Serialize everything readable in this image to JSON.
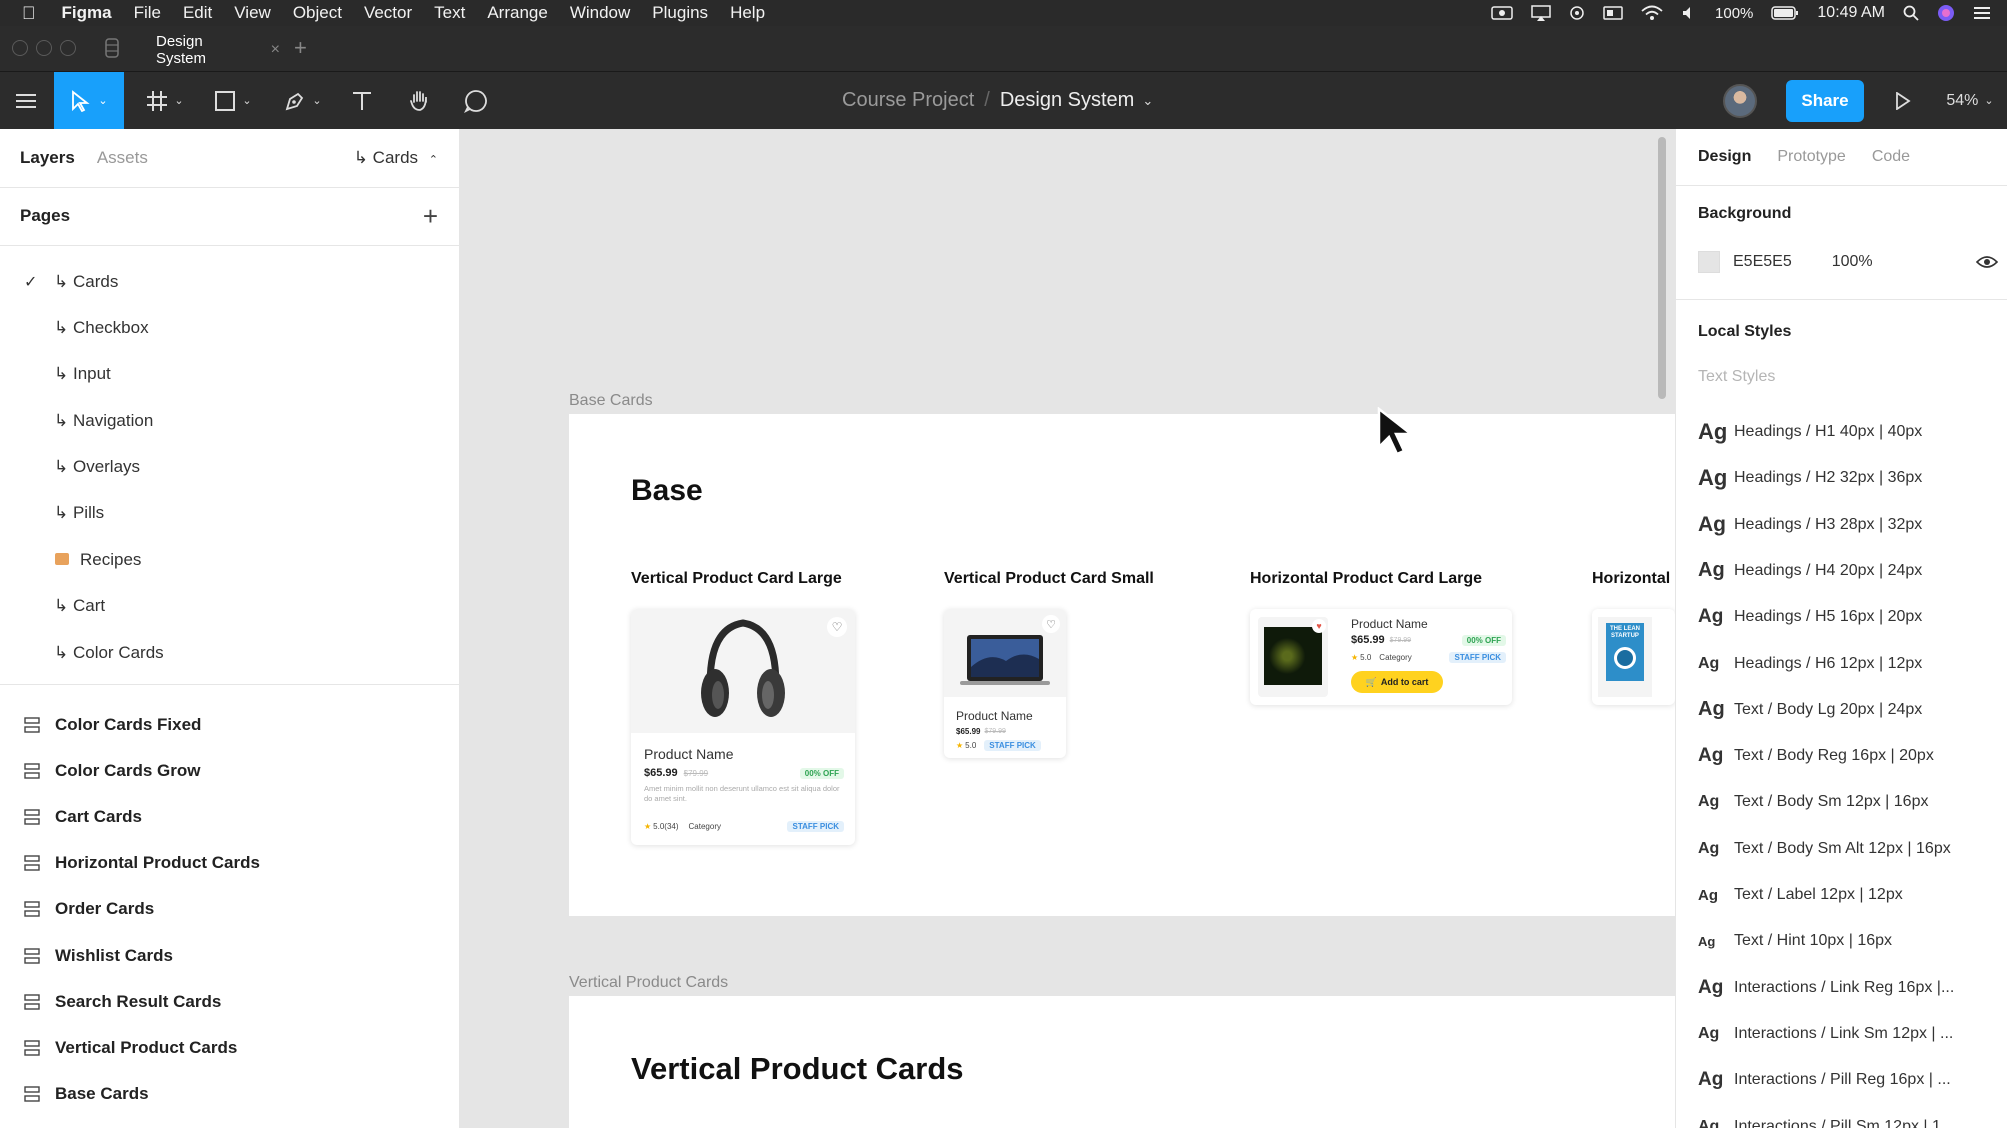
{
  "menubar": {
    "app": "Figma",
    "items": [
      "File",
      "Edit",
      "View",
      "Object",
      "Vector",
      "Text",
      "Arrange",
      "Window",
      "Plugins",
      "Help"
    ],
    "battery": "100%",
    "time": "10:49 AM"
  },
  "tabbar": {
    "tab_label": "Design System"
  },
  "toolbar": {
    "project": "Course Project",
    "separator": "/",
    "file": "Design System",
    "share_label": "Share",
    "zoom": "54%",
    "accent": "#18a0fb"
  },
  "left_panel": {
    "tabs": [
      "Layers",
      "Assets"
    ],
    "current_page_label": "↳ Cards",
    "pages_title": "Pages",
    "pages": [
      "↳ Cards",
      "↳ Checkbox",
      "↳ Input",
      "↳ Navigation",
      "↳ Overlays",
      "↳ Pills",
      "Recipes",
      "↳ Cart",
      "↳ Color Cards"
    ],
    "layers": [
      "Color Cards Fixed",
      "Color Cards Grow",
      "Cart Cards",
      "Horizontal Product Cards",
      "Order Cards",
      "Wishlist Cards",
      "Search Result Cards",
      "Vertical Product Cards",
      "Base Cards"
    ]
  },
  "canvas": {
    "frame1_label": "Base Cards",
    "frame1_heading": "Base",
    "col1_title": "Vertical Product Card Large",
    "col2_title": "Vertical Product Card Small",
    "col3_title": "Horizontal Product Card Large",
    "col4_title": "Horizontal",
    "card_large": {
      "name": "Product Name",
      "price": "$65.99",
      "old_price": "$79.99",
      "discount": "00% OFF",
      "desc": "Amet minim mollit non deserunt ullamco est sit aliqua dolor do amet sint.",
      "rating": "5.0(34)",
      "category": "Category",
      "badge": "STAFF PICK"
    },
    "card_small": {
      "name": "Product Name",
      "price": "$65.99",
      "old_price": "$79.99",
      "rating": "5.0",
      "badge": "STAFF PICK"
    },
    "card_horizontal": {
      "name": "Product Name",
      "price": "$65.99",
      "old_price": "$79.99",
      "discount": "00% OFF",
      "rating": "5.0",
      "category": "Category",
      "badge": "STAFF PICK",
      "cart_button": "Add to cart"
    },
    "book_text": "THE LEAN STARTUP",
    "frame2_label": "Vertical Product Cards",
    "frame2_heading": "Vertical Product Cards"
  },
  "right_panel": {
    "tabs": [
      "Design",
      "Prototype",
      "Code"
    ],
    "background_title": "Background",
    "bg_hex": "E5E5E5",
    "bg_opacity": "100%",
    "bg_color": "#e5e5e5",
    "local_styles_title": "Local Styles",
    "text_styles_title": "Text Styles",
    "ag": "Ag",
    "styles": [
      "Headings / H1 40px | 40px",
      "Headings / H2 32px | 36px",
      "Headings / H3 28px | 32px",
      "Headings / H4 20px | 24px",
      "Headings / H5 16px | 20px",
      "Headings / H6 12px | 12px",
      "Text / Body Lg 20px | 24px",
      "Text / Body Reg 16px | 20px",
      "Text / Body Sm 12px | 16px",
      "Text / Body Sm Alt 12px | 16px",
      "Text / Label 12px | 12px",
      "Text / Hint 10px | 16px",
      "Interactions / Link Reg 16px |...",
      "Interactions / Link Sm 12px | ...",
      "Interactions / Pill Reg 16px | ...",
      "Interactions / Pill Sm 12px | 1..."
    ]
  }
}
